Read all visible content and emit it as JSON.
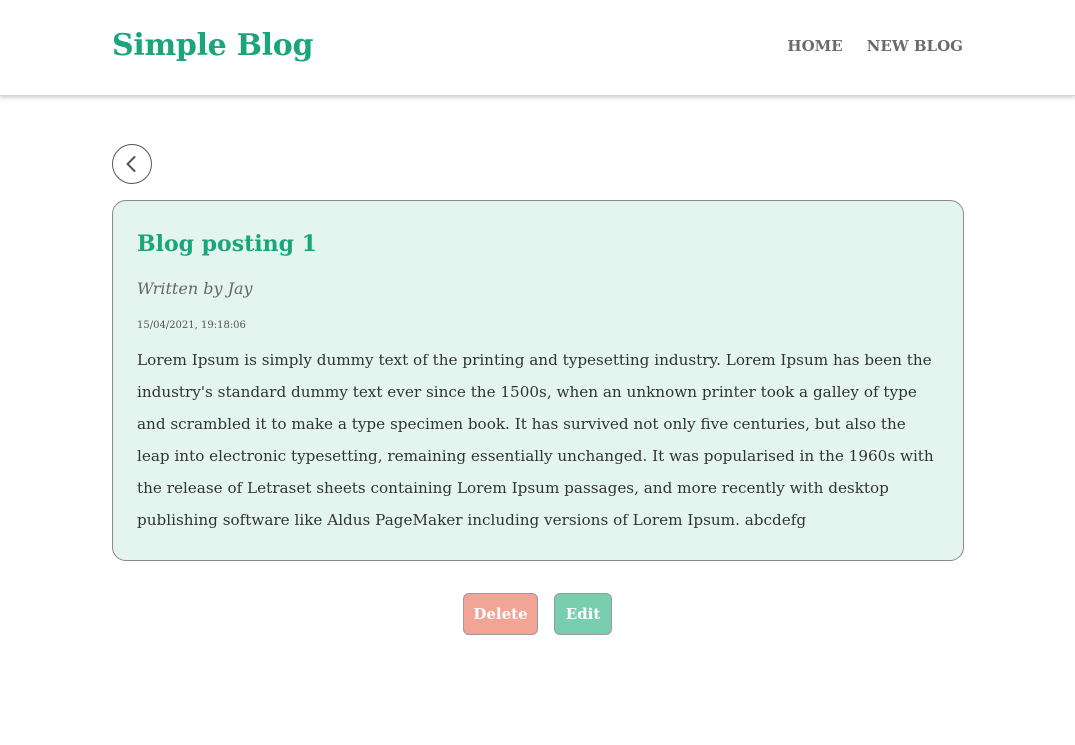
{
  "header": {
    "brand": "Simple Blog",
    "nav": [
      {
        "label": "HOME"
      },
      {
        "label": "NEW BLOG"
      }
    ]
  },
  "back_button": {
    "icon": "chevron-left-icon"
  },
  "post": {
    "title": "Blog posting 1",
    "author_line": "Written by Jay",
    "timestamp": "15/04/2021, 19:18:06",
    "body": "Lorem Ipsum is simply dummy text of the printing and typesetting industry. Lorem Ipsum has been the industry's standard dummy text ever since the 1500s, when an unknown printer took a galley of type and scrambled it to make a type specimen book. It has survived not only five centuries, but also the leap into electronic typesetting, remaining essentially unchanged. It was popularised in the 1960s with the release of Letraset sheets containing Lorem Ipsum passages, and more recently with desktop publishing software like Aldus PageMaker including versions of Lorem Ipsum. abcdefg"
  },
  "actions": {
    "delete_label": "Delete",
    "edit_label": "Edit"
  },
  "colors": {
    "brand": "#1aa67a",
    "card_bg": "#e3f5ee",
    "delete_bg": "#f2a497",
    "edit_bg": "#78cfb0"
  }
}
